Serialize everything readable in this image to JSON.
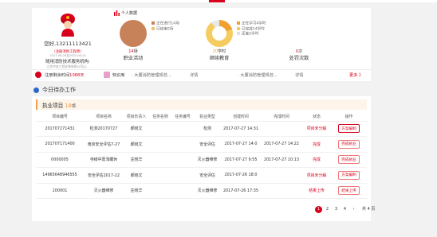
{
  "user": {
    "name": "您好,13211113421",
    "cert_label": "（注册消防工程师）",
    "cert_date": "2017-06-26至2020-06-24",
    "company": "随用消防技术服务机构:",
    "company_sub": "江苏中安工程安装有限公司山..."
  },
  "stats": {
    "title": "个人数据",
    "activity": {
      "value": "14",
      "unit": "场",
      "label": "职业活动",
      "legend": [
        "正在进行14场",
        "已结束0场"
      ],
      "colors": [
        "#c8825a",
        "#f0c080"
      ]
    },
    "education": {
      "value": "20",
      "unit": "学时",
      "label": "继续教育",
      "legend": [
        "正在学习4学时",
        "已完成14学时",
        "还差2学时"
      ],
      "colors": [
        "#f0a030",
        "#f5cc60",
        "#e0e0e0"
      ]
    },
    "penalty": {
      "value": "0",
      "unit": "次",
      "label": "处罚次数"
    }
  },
  "strip": {
    "register_label": "注册剩余时间",
    "register_days": "1068天",
    "knowledge_label": "知识库",
    "item1": "· 大厦消防管理规范...",
    "detail1": "详情",
    "item2": "· 大厦消防管理规范...",
    "detail2": "详情",
    "more": "更多 》"
  },
  "todo": {
    "title": "今日待办工作",
    "exec_label": "执业项目",
    "exec_count": "18",
    "exec_unit": "项"
  },
  "table": {
    "headers": [
      "项目编号",
      "项目名称",
      "项目负责人",
      "任务名称",
      "任务编号",
      "执业类型",
      "创建时间",
      "完成时间",
      "状态",
      "操作"
    ],
    "rows": [
      [
        "201707271431",
        "检测20170727",
        "郝晓文",
        "",
        "",
        "检测",
        "2017-07-27 14:31",
        "",
        "项目未分解",
        "方案编制"
      ],
      [
        "201707171400",
        "南京安全评估7-27",
        "郝晓文",
        "",
        "",
        "安全评估",
        "2017-07-27 14:0",
        "2017-07-27 14:22",
        "完成",
        "完成执业"
      ],
      [
        "0000005",
        "寺様中葛淘藏休",
        "庄晓华",
        "",
        "",
        "灭火器维修",
        "2017-07-27 9:55",
        "2017-07-27 10:13",
        "完成",
        "完成执业"
      ],
      [
        "14965648946555",
        "安全评估2017-22",
        "郝晓文",
        "",
        "",
        "安全评估",
        "2017-07-26 18:0",
        "",
        "项目未分解",
        "方案编制"
      ],
      [
        "100001",
        "灭火器维修",
        "庄晓华",
        "",
        "",
        "灭火器维修",
        "2017-07-26 17:35",
        "",
        "结果上传",
        "结果上传"
      ]
    ]
  },
  "pager": {
    "pages": [
      "1",
      "2",
      "3",
      "4"
    ],
    "next": "›",
    "total": "共 4 页"
  },
  "colors": {
    "accent": "#d9001b",
    "orange": "#f0a050",
    "blue": "#2a68c8"
  }
}
